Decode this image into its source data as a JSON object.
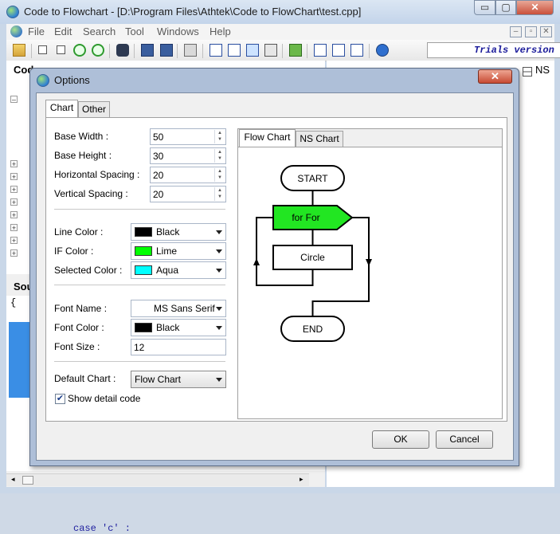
{
  "window": {
    "title": "Code to Flowchart - [D:\\Program Files\\Athtek\\Code to FlowChart\\test.cpp]",
    "min": "▭",
    "max": "▢",
    "close": "✕"
  },
  "menu": {
    "items": [
      "File",
      "Edit",
      "Search",
      "Tool",
      "Windows",
      "Help"
    ]
  },
  "mdi": {
    "min": "–",
    "restore": "▫",
    "close": "✕"
  },
  "toolbar": {
    "icons": [
      "open-icon",
      "expand-icon",
      "collapse-icon",
      "zoom-in-icon",
      "zoom-out-icon",
      "find-icon",
      "save-icon",
      "save-all-icon",
      "print-icon",
      "word-export-icon",
      "export-icon",
      "image-export-icon",
      "share-icon",
      "tools-icon",
      "flowchart-view-icon",
      "horizontal-layout-icon",
      "vertical-layout-icon",
      "help-icon"
    ],
    "trial_text": "Trials version"
  },
  "left_panel": {
    "code_label": "Code",
    "source_label": "Sou",
    "brace": "{",
    "code_snippet": "case 'c' :"
  },
  "right_panel": {
    "ns_tab": "NS"
  },
  "dialog": {
    "title": "Options",
    "close": "✕",
    "tabs": [
      "Chart",
      "Other"
    ],
    "fields": {
      "base_width": {
        "label": "Base Width :",
        "value": "50"
      },
      "base_height": {
        "label": "Base Height :",
        "value": "30"
      },
      "h_spacing": {
        "label": "Horizontal Spacing :",
        "value": "20"
      },
      "v_spacing": {
        "label": "Vertical Spacing :",
        "value": "20"
      },
      "line_color": {
        "label": "Line Color :",
        "value": "Black",
        "color": "#000000"
      },
      "if_color": {
        "label": "IF Color :",
        "value": "Lime",
        "color": "#00ff00"
      },
      "selected_color": {
        "label": "Selected Color :",
        "value": "Aqua",
        "color": "#00ffff"
      },
      "font_name": {
        "label": "Font Name :",
        "value": "MS Sans Serif"
      },
      "font_color": {
        "label": "Font Color :",
        "value": "Black",
        "color": "#000000"
      },
      "font_size": {
        "label": "Font Size :",
        "value": "12"
      },
      "default_chart": {
        "label": "Default Chart :",
        "value": "Flow Chart"
      },
      "show_detail": {
        "label": "Show detail code",
        "checked": true
      }
    },
    "preview_tabs": [
      "Flow Chart",
      "NS Chart"
    ],
    "flowchart": {
      "start": "START",
      "loop": "for For",
      "process": "Circle",
      "end": "END",
      "loop_color": "#22e622"
    },
    "buttons": {
      "ok": "OK",
      "cancel": "Cancel"
    }
  }
}
